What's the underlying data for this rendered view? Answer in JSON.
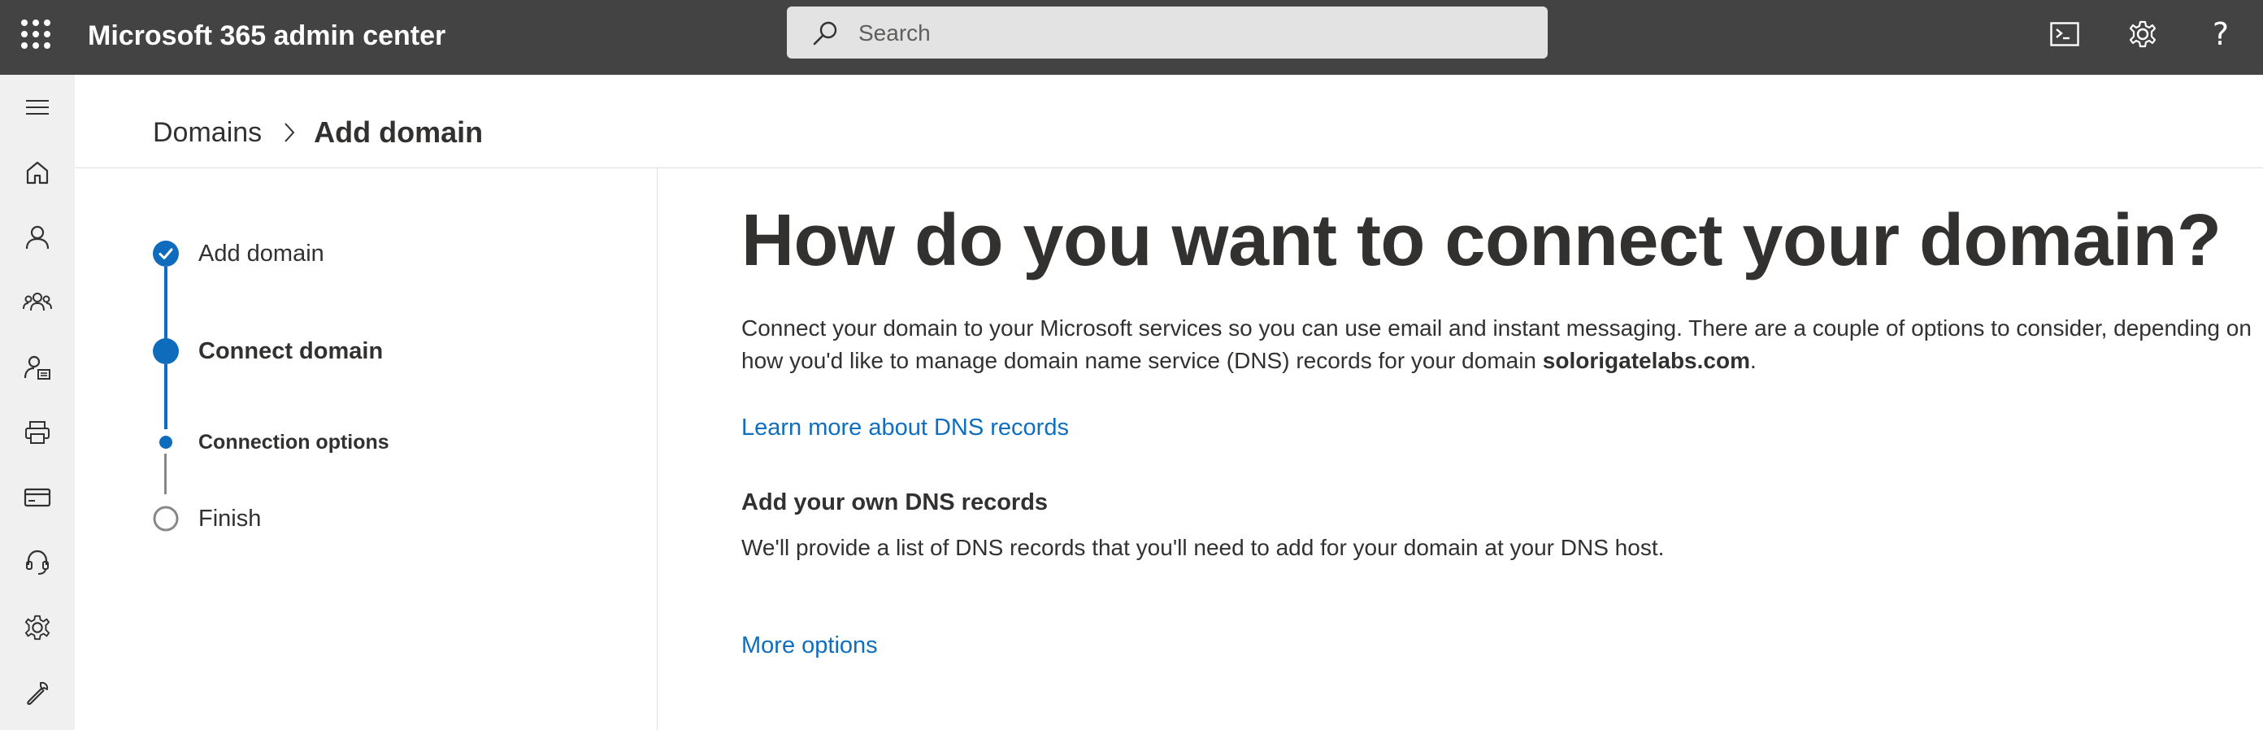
{
  "header": {
    "app_title": "Microsoft 365 admin center",
    "search_placeholder": "Search",
    "icons": [
      "app-launcher-icon",
      "search-icon",
      "terminal-icon",
      "gear-icon",
      "help-icon"
    ]
  },
  "leftnav": {
    "items": [
      "menu-icon",
      "home-icon",
      "user-icon",
      "group-icon",
      "roles-icon",
      "printer-icon",
      "billing-icon",
      "support-icon",
      "settings-icon",
      "setup-icon"
    ]
  },
  "breadcrumb": {
    "parent": "Domains",
    "current": "Add domain"
  },
  "stepper": {
    "steps": [
      {
        "label": "Add domain",
        "state": "completed"
      },
      {
        "label": "Connect domain",
        "state": "current"
      },
      {
        "label": "Connection options",
        "state": "current-substep"
      },
      {
        "label": "Finish",
        "state": "pending"
      }
    ]
  },
  "main": {
    "heading": "How do you want to connect your domain?",
    "description_before": "Connect your domain to your Microsoft services so you can use email and instant messaging. There are a couple of options to consider, depending on how you'd like to manage domain name service (DNS) records for your domain ",
    "domain_name": "solorigatelabs.com",
    "description_after": ".",
    "learn_more_link": "Learn more about DNS records",
    "option_title": "Add your own DNS records",
    "option_text": "We'll provide a list of DNS records that you'll need to add for your domain at your DNS host.",
    "more_options_link": "More options"
  },
  "colors": {
    "topbar": "#434343",
    "accent": "#0f6cbd",
    "link": "#106ebe",
    "nav_bg": "#f0f0f0"
  }
}
